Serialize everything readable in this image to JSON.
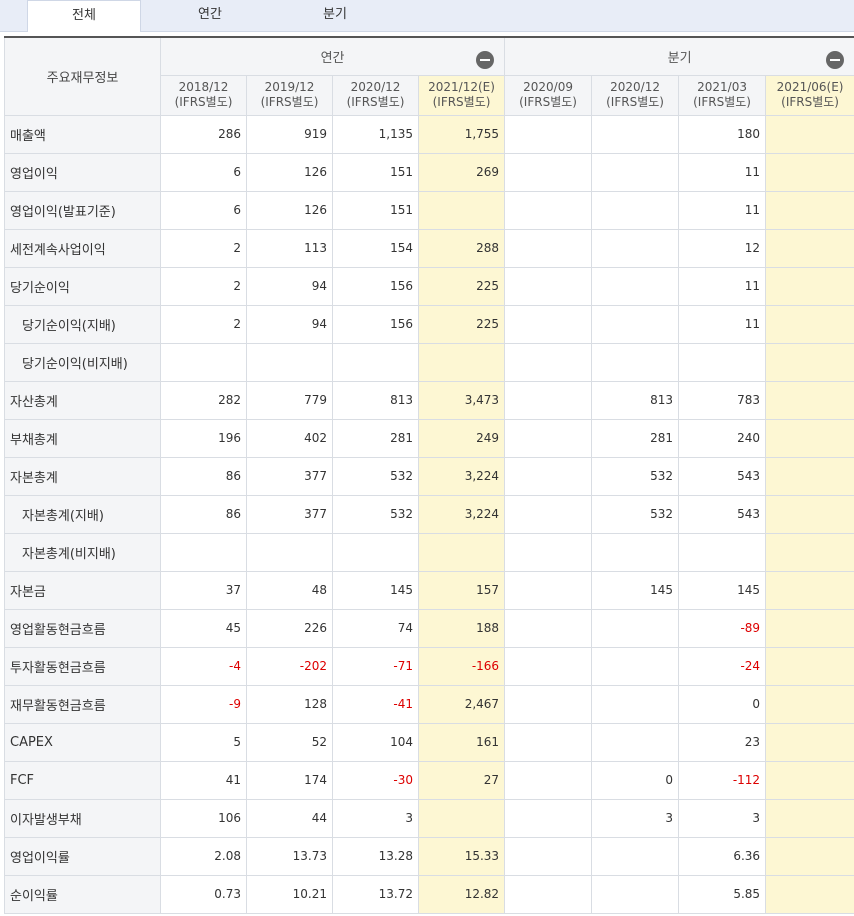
{
  "tabs": [
    "전체",
    "연간",
    "분기"
  ],
  "corner_label": "주요재무정보",
  "groups": {
    "annual": "연간",
    "quarterly": "분기"
  },
  "columns": [
    {
      "period": "2018/12",
      "basis": "(IFRS별도)"
    },
    {
      "period": "2019/12",
      "basis": "(IFRS별도)"
    },
    {
      "period": "2020/12",
      "basis": "(IFRS별도)"
    },
    {
      "period": "2021/12(E)",
      "basis": "(IFRS별도)"
    },
    {
      "period": "2020/09",
      "basis": "(IFRS별도)"
    },
    {
      "period": "2020/12",
      "basis": "(IFRS별도)"
    },
    {
      "period": "2021/03",
      "basis": "(IFRS별도)"
    },
    {
      "period": "2021/06(E)",
      "basis": "(IFRS별도)"
    }
  ],
  "rows": [
    {
      "label": "매출액",
      "indent": false,
      "values": [
        "286",
        "919",
        "1,135",
        "1,755",
        "",
        "",
        "180",
        ""
      ]
    },
    {
      "label": "영업이익",
      "indent": false,
      "values": [
        "6",
        "126",
        "151",
        "269",
        "",
        "",
        "11",
        ""
      ]
    },
    {
      "label": "영업이익(발표기준)",
      "indent": false,
      "values": [
        "6",
        "126",
        "151",
        "",
        "",
        "",
        "11",
        ""
      ]
    },
    {
      "label": "세전계속사업이익",
      "indent": false,
      "values": [
        "2",
        "113",
        "154",
        "288",
        "",
        "",
        "12",
        ""
      ]
    },
    {
      "label": "당기순이익",
      "indent": false,
      "values": [
        "2",
        "94",
        "156",
        "225",
        "",
        "",
        "11",
        ""
      ]
    },
    {
      "label": "당기순이익(지배)",
      "indent": true,
      "values": [
        "2",
        "94",
        "156",
        "225",
        "",
        "",
        "11",
        ""
      ]
    },
    {
      "label": "당기순이익(비지배)",
      "indent": true,
      "values": [
        "",
        "",
        "",
        "",
        "",
        "",
        "",
        ""
      ]
    },
    {
      "label": "자산총계",
      "indent": false,
      "values": [
        "282",
        "779",
        "813",
        "3,473",
        "",
        "813",
        "783",
        ""
      ]
    },
    {
      "label": "부채총계",
      "indent": false,
      "values": [
        "196",
        "402",
        "281",
        "249",
        "",
        "281",
        "240",
        ""
      ]
    },
    {
      "label": "자본총계",
      "indent": false,
      "values": [
        "86",
        "377",
        "532",
        "3,224",
        "",
        "532",
        "543",
        ""
      ]
    },
    {
      "label": "자본총계(지배)",
      "indent": true,
      "values": [
        "86",
        "377",
        "532",
        "3,224",
        "",
        "532",
        "543",
        ""
      ]
    },
    {
      "label": "자본총계(비지배)",
      "indent": true,
      "values": [
        "",
        "",
        "",
        "",
        "",
        "",
        "",
        ""
      ]
    },
    {
      "label": "자본금",
      "indent": false,
      "values": [
        "37",
        "48",
        "145",
        "157",
        "",
        "145",
        "145",
        ""
      ]
    },
    {
      "label": "영업활동현금흐름",
      "indent": false,
      "values": [
        "45",
        "226",
        "74",
        "188",
        "",
        "",
        "-89",
        ""
      ]
    },
    {
      "label": "투자활동현금흐름",
      "indent": false,
      "values": [
        "-4",
        "-202",
        "-71",
        "-166",
        "",
        "",
        "-24",
        ""
      ]
    },
    {
      "label": "재무활동현금흐름",
      "indent": false,
      "values": [
        "-9",
        "128",
        "-41",
        "2,467",
        "",
        "",
        "0",
        ""
      ]
    },
    {
      "label": "CAPEX",
      "indent": false,
      "values": [
        "5",
        "52",
        "104",
        "161",
        "",
        "",
        "23",
        ""
      ]
    },
    {
      "label": "FCF",
      "indent": false,
      "values": [
        "41",
        "174",
        "-30",
        "27",
        "",
        "0",
        "-112",
        ""
      ]
    },
    {
      "label": "이자발생부채",
      "indent": false,
      "values": [
        "106",
        "44",
        "3",
        "",
        "",
        "3",
        "3",
        ""
      ]
    },
    {
      "label": "영업이익률",
      "indent": false,
      "values": [
        "2.08",
        "13.73",
        "13.28",
        "15.33",
        "",
        "",
        "6.36",
        ""
      ]
    },
    {
      "label": "순이익률",
      "indent": false,
      "values": [
        "0.73",
        "10.21",
        "13.72",
        "12.82",
        "",
        "",
        "5.85",
        ""
      ]
    }
  ],
  "colors": {
    "estimate_bg": "#fdf7d3",
    "negative": "#dd0000",
    "header_bg": "#f4f5f7"
  }
}
